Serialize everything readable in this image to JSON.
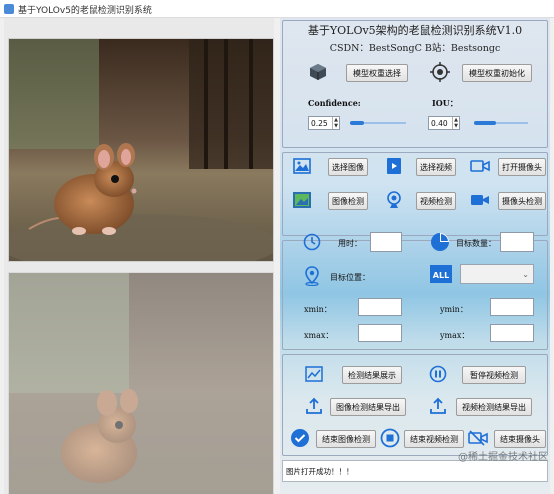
{
  "window": {
    "title": "基于YOLOv5的老鼠检测识别系统"
  },
  "header": {
    "title": "基于YOLOv5架构的老鼠检测识别系统V1.0",
    "sub": "CSDN：BestSongC   B站：Bestsongc"
  },
  "model": {
    "select_label": "模型权重选择",
    "init_label": "模型权重初始化"
  },
  "params": {
    "confidence_label": "Confidence:",
    "iou_label": "IOU：",
    "confidence_value": "0.25",
    "iou_value": "0.40",
    "confidence_level": 0.25,
    "iou_level": 0.4
  },
  "buttons": {
    "select_image": "选择图像",
    "select_video": "选择视频",
    "open_camera": "打开摄像头",
    "detect_image": "图像检测",
    "detect_video": "视频检测",
    "detect_camera": "摄像头检测",
    "show_result": "检测结果展示",
    "pause_video": "暂停视频检测",
    "export_image": "图像检测结果导出",
    "export_video": "视频检测结果导出",
    "end_image": "结束图像检测",
    "end_video": "结束视频检测",
    "end_camera": "结束摄像头"
  },
  "stats": {
    "time_label": "用时：",
    "count_label": "目标数量：",
    "position_label": "目标位置：",
    "xmin_label": "xmin：",
    "ymin_label": "ymin：",
    "xmax_label": "xmax：",
    "ymax_label": "ymax："
  },
  "status": {
    "message": "图片打开成功！！！"
  },
  "watermark": "@稀土掘金技术社区",
  "colors": {
    "accent": "#1e6fd6",
    "border": "#9aa9bd"
  }
}
